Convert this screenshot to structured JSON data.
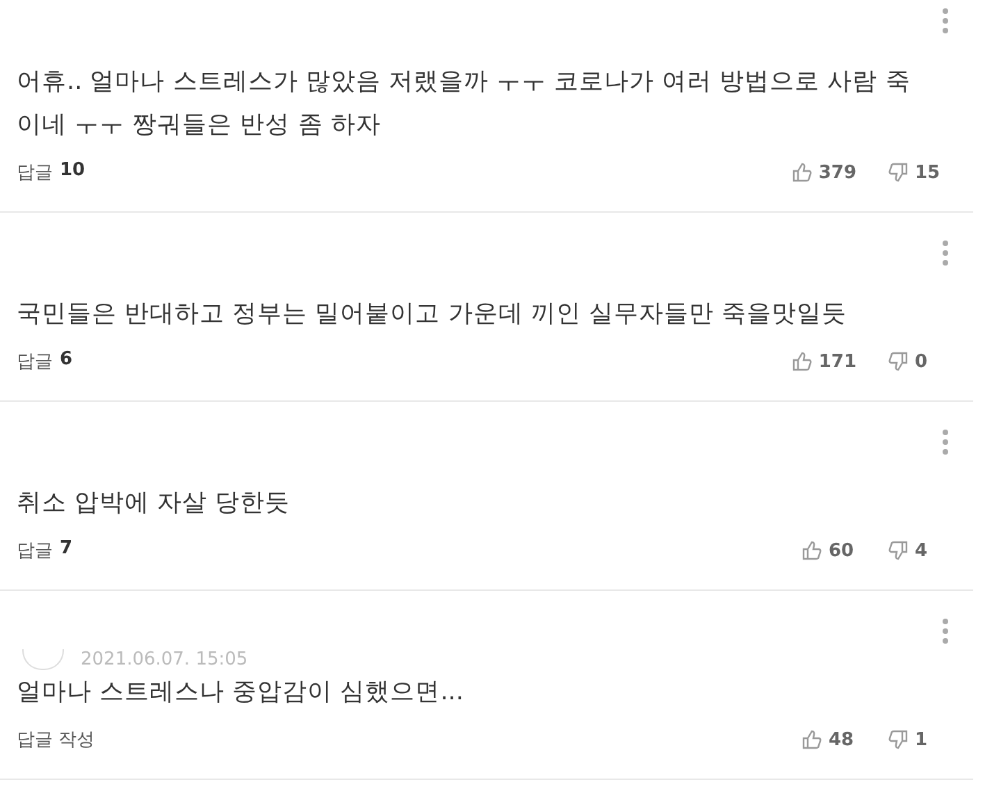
{
  "comments": [
    {
      "text": "어휴.. 얼마나 스트레스가 많았음 저랬을까 ㅜㅜ 코로나가 여러 방법으로 사람 죽이네 ㅜㅜ 짱궈들은 반성 좀 하자",
      "reply_label": "답글",
      "reply_count": "10",
      "likes": "379",
      "dislikes": "15"
    },
    {
      "text": "국민들은 반대하고 정부는 밀어붙이고 가운데 끼인 실무자들만 죽을맛일듯",
      "reply_label": "답글",
      "reply_count": "6",
      "likes": "171",
      "dislikes": "0"
    },
    {
      "text": "취소 압박에 자살 당한듯",
      "reply_label": "답글",
      "reply_count": "7",
      "likes": "60",
      "dislikes": "4"
    },
    {
      "date": "2021.06.07. 15:05",
      "text": "얼마나 스트레스나 중압감이 심했으면...",
      "reply_label": "답글 작성",
      "likes": "48",
      "dislikes": "1"
    }
  ]
}
